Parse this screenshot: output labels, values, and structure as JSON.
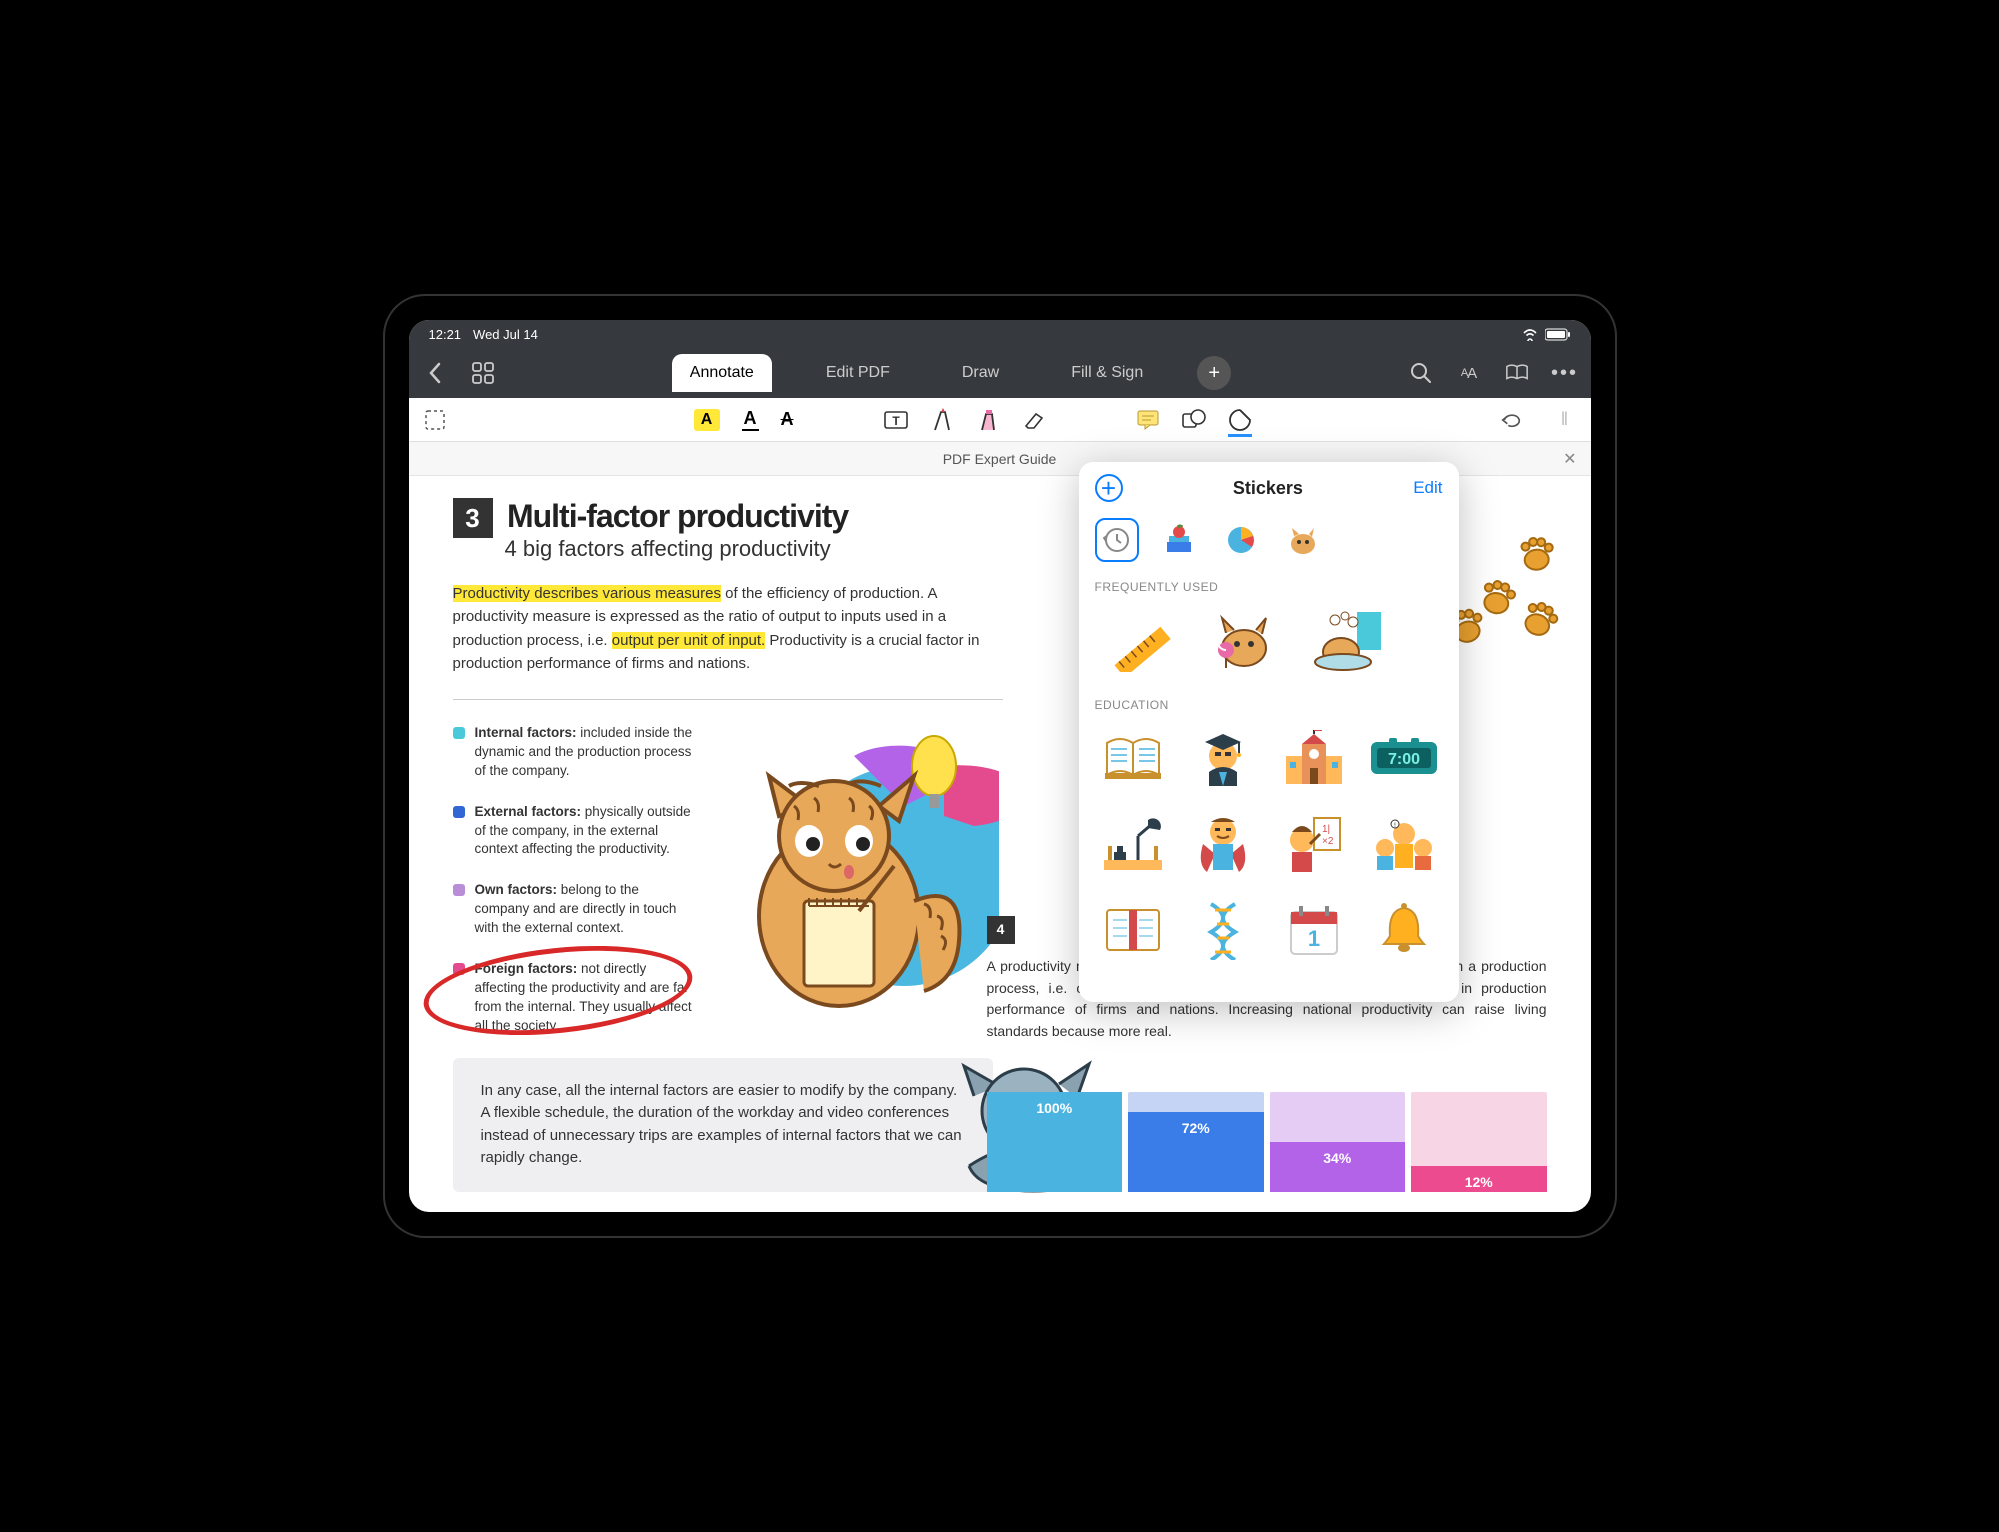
{
  "status": {
    "time": "12:21",
    "date": "Wed Jul 14"
  },
  "toolbar": {
    "tabs": [
      "Annotate",
      "Edit PDF",
      "Draw",
      "Fill & Sign"
    ],
    "active_tab": "Annotate"
  },
  "doc_title": "PDF Expert Guide",
  "section": {
    "number": "3",
    "title": "Multi-factor productivity",
    "subtitle": "4 big factors affecting productivity",
    "para1_hl1": "Productivity describes various measures",
    "para1_mid": " of the efficiency of production. A productivity measure is expressed as the ratio of output to inputs used in a production process, i.e. ",
    "para1_hl2": "output per unit of input.",
    "para1_end": " Productivity is a crucial factor in production performance of firms and nations."
  },
  "factors": [
    {
      "color": "c-cyan",
      "label": "Internal factors:",
      "text": " included inside the dynamic and the production process of the company."
    },
    {
      "color": "c-blue",
      "label": "External factors:",
      "text": " physically outside of the company, in the external context affecting the productivity."
    },
    {
      "color": "c-purple",
      "label": "Own factors:",
      "text": " belong to the company and are directly in touch with the external context."
    },
    {
      "color": "c-pink",
      "label": "Foreign factors:",
      "text": " not directly affecting the productivity and are far from the internal. They usually affect all the society."
    }
  ],
  "note": "In any case, all the internal factors are easier to modify by the company. A flexible schedule, the duration of the workday and video conferences instead of unnecessary trips are examples of internal factors that we can rapidly change.",
  "section4": {
    "number": "4",
    "body": "A productivity measure is expressed as the ratio of output to inputs used in a production process, i.e. output per unit of input. Productivity is a crucial factor in production performance of firms and nations. Increasing national productivity can raise living standards because more real."
  },
  "chart_data": {
    "type": "bar",
    "categories": [
      "",
      "",
      "",
      ""
    ],
    "values": [
      100,
      72,
      34,
      12
    ],
    "labels": [
      "100%",
      "72%",
      "34%",
      "12%"
    ],
    "colors": [
      "#4ab3e0",
      "#3a7ce8",
      "#b263e8",
      "#ed4b8f"
    ],
    "bg_colors": [
      "#c3e1f5",
      "#c5d4f4",
      "#e4ccf5",
      "#f8d5e4"
    ]
  },
  "stickers": {
    "title": "Stickers",
    "edit": "Edit",
    "freq_label": "FREQUENTLY USED",
    "edu_label": "EDUCATION",
    "categories": [
      "history",
      "books",
      "pie-chart",
      "cat"
    ],
    "frequent": [
      "ruler",
      "cat-lollipop",
      "cat-bath"
    ],
    "education": [
      "open-book",
      "graduate",
      "school",
      "clock-700",
      "desk-lamp",
      "student-cape",
      "teacher",
      "class",
      "notebook",
      "dna",
      "calendar-1",
      "bell"
    ]
  }
}
